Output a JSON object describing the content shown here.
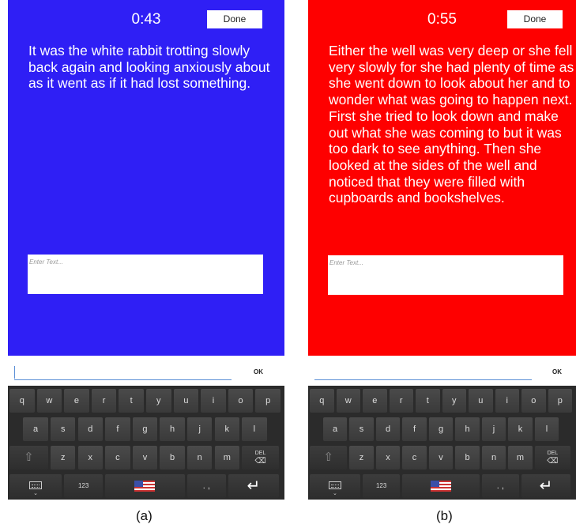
{
  "panel_a": {
    "timer": "0:43",
    "done_label": "Done",
    "background": "#2f1ff5",
    "passage": "It was the white rabbit trotting slowly back again and looking anxiously about as it went as if it had lost something.",
    "entry_placeholder": "Enter Text...",
    "ok_label": "OK",
    "caption": "(a)"
  },
  "panel_b": {
    "timer": "0:55",
    "done_label": "Done",
    "background": "#fe0000",
    "passage": "Either the well was very deep or she fell very slowly for she had plenty of time as she went down to look about her and to wonder what was going to happen next. First she tried to look down and make out what she was coming to but it was too dark to see anything. Then she looked at the sides of the well and noticed that they were filled with cupboards and bookshelves.",
    "entry_placeholder": "Enter Text...",
    "ok_label": "OK",
    "caption": "(b)"
  },
  "keyboard": {
    "row1": [
      "q",
      "w",
      "e",
      "r",
      "t",
      "y",
      "u",
      "i",
      "o",
      "p"
    ],
    "row2": [
      "a",
      "s",
      "d",
      "f",
      "g",
      "h",
      "j",
      "k",
      "l"
    ],
    "row3": [
      "z",
      "x",
      "c",
      "v",
      "b",
      "n",
      "m"
    ],
    "del_label": "DEL",
    "del_icon": "⌫",
    "shift_icon": "⇧",
    "numbers_label": "123",
    "punct_label": ". ,",
    "enter_icon": "↵",
    "keyboard_icon": "keyboard-icon",
    "language_icon": "us-flag-icon"
  }
}
